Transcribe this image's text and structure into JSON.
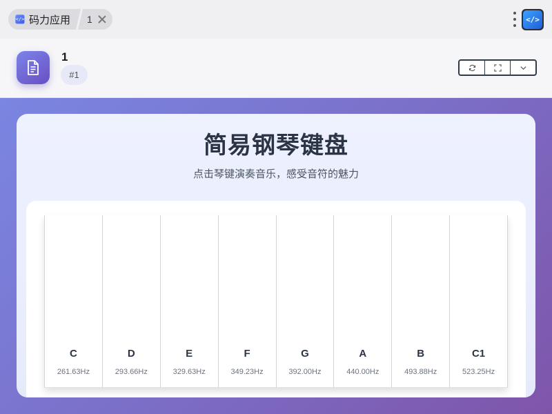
{
  "tab": {
    "title": "码力应用",
    "number": "1"
  },
  "header": {
    "title": "1",
    "badge": "#1",
    "actions": [
      "refresh-icon",
      "fullscreen-icon",
      "chevron-down-icon"
    ]
  },
  "app": {
    "title": "简易钢琴键盘",
    "subtitle": "点击琴键演奏音乐，感受音符的魅力",
    "keys": [
      {
        "note": "C",
        "freq": "261.63Hz"
      },
      {
        "note": "D",
        "freq": "293.66Hz"
      },
      {
        "note": "E",
        "freq": "329.63Hz"
      },
      {
        "note": "F",
        "freq": "349.23Hz"
      },
      {
        "note": "G",
        "freq": "392.00Hz"
      },
      {
        "note": "A",
        "freq": "440.00Hz"
      },
      {
        "note": "B",
        "freq": "493.88Hz"
      },
      {
        "note": "C1",
        "freq": "523.25Hz"
      }
    ]
  },
  "colors": {
    "gradient_start": "#7a86e2",
    "gradient_end": "#7f55aa",
    "accent_icon": "#6a4fc4"
  }
}
